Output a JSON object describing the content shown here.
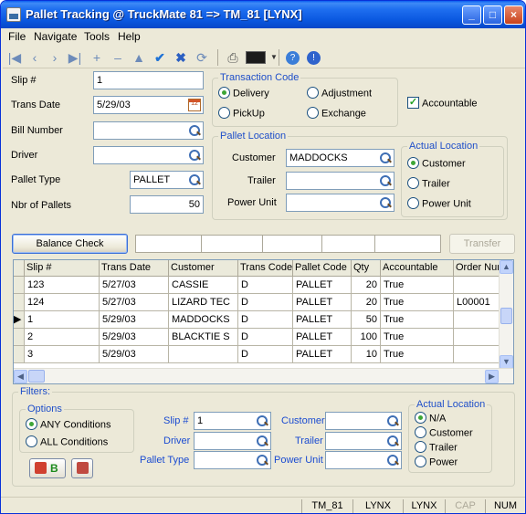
{
  "window": {
    "title": "Pallet Tracking @ TruckMate 81 => TM_81 [LYNX]",
    "controls": {
      "minimize": "_",
      "maximize": "□",
      "close": "×"
    }
  },
  "menu": [
    "File",
    "Navigate",
    "Tools",
    "Help"
  ],
  "toolbar": {
    "icons": [
      "first-icon",
      "prev-icon",
      "next-icon",
      "last-icon",
      "add-icon",
      "delete-icon",
      "up-icon",
      "post-icon",
      "cancel-icon",
      "refresh-icon",
      "print-icon",
      "monitor-icon",
      "help-icon",
      "info-icon"
    ],
    "glyphs": {
      "first": "|◀",
      "prev": "‹",
      "next": "›",
      "last": "▶|",
      "add": "+",
      "delete": "–",
      "up": "▲",
      "check": "✔",
      "cancel": "✖",
      "refresh": "⟳",
      "print": "⎙",
      "help": "?",
      "info": "!"
    }
  },
  "form": {
    "slip_label": "Slip #",
    "slip_value": "1",
    "trans_date_label": "Trans Date",
    "trans_date_value": "5/29/03",
    "bill_number_label": "Bill Number",
    "bill_number_value": "",
    "driver_label": "Driver",
    "driver_value": "",
    "pallet_type_label": "Pallet Type",
    "pallet_type_value": "PALLET",
    "nbr_pallets_label": "Nbr of Pallets",
    "nbr_pallets_value": "50",
    "calendar_text": "12"
  },
  "transaction_code": {
    "title": "Transaction Code",
    "options": [
      {
        "label": "Delivery",
        "selected": true
      },
      {
        "label": "Adjustment",
        "selected": false
      },
      {
        "label": "PickUp",
        "selected": false
      },
      {
        "label": "Exchange",
        "selected": false
      }
    ]
  },
  "accountable": {
    "label": "Accountable",
    "checked": true,
    "mark": "✓"
  },
  "pallet_location": {
    "title": "Pallet Location",
    "customer_label": "Customer",
    "customer_value": "MADDOCKS",
    "trailer_label": "Trailer",
    "trailer_value": "",
    "power_unit_label": "Power Unit",
    "power_unit_value": ""
  },
  "actual_location": {
    "title": "Actual Location",
    "options": [
      {
        "label": "Customer",
        "selected": true
      },
      {
        "label": "Trailer",
        "selected": false
      },
      {
        "label": "Power Unit",
        "selected": false
      }
    ]
  },
  "actions": {
    "balance_check": "Balance Check",
    "transfer": "Transfer"
  },
  "grid": {
    "columns": [
      "Slip #",
      "Trans Date",
      "Customer",
      "Trans Code",
      "Pallet Code",
      "Qty",
      "Accountable",
      "Order Nur"
    ],
    "current_marker": "▶",
    "rows": [
      {
        "slip": "123",
        "date": "5/27/03",
        "customer": "CASSIE",
        "code": "D",
        "pallet": "PALLET",
        "qty": "20",
        "acct": "True",
        "order": ""
      },
      {
        "slip": "124",
        "date": "5/27/03",
        "customer": "LIZARD TEC",
        "code": "D",
        "pallet": "PALLET",
        "qty": "20",
        "acct": "True",
        "order": "L00001"
      },
      {
        "slip": "1",
        "date": "5/29/03",
        "customer": "MADDOCKS",
        "code": "D",
        "pallet": "PALLET",
        "qty": "50",
        "acct": "True",
        "order": ""
      },
      {
        "slip": "2",
        "date": "5/29/03",
        "customer": "BLACKTIE S",
        "code": "D",
        "pallet": "PALLET",
        "qty": "100",
        "acct": "True",
        "order": ""
      },
      {
        "slip": "3",
        "date": "5/29/03",
        "customer": "",
        "code": "D",
        "pallet": "PALLET",
        "qty": "10",
        "acct": "True",
        "order": ""
      }
    ],
    "scroll_glyphs": {
      "up": "▲",
      "down": "▼",
      "left": "◀",
      "right": "▶"
    }
  },
  "filters": {
    "title": "Filters:",
    "options_title": "Options",
    "options": [
      {
        "label": "ANY Conditions",
        "selected": true
      },
      {
        "label": "ALL Conditions",
        "selected": false
      }
    ],
    "slip_label": "Slip #",
    "slip_value": "1",
    "driver_label": "Driver",
    "driver_value": "",
    "pallet_type_label": "Pallet Type",
    "pallet_type_value": "",
    "customer_label": "Customer",
    "customer_value": "",
    "trailer_label": "Trailer",
    "trailer_value": "",
    "power_unit_label": "Power Unit",
    "power_unit_value": "",
    "actual_location_title": "Actual Location",
    "actual_location_options": [
      {
        "label": "N/A",
        "selected": true
      },
      {
        "label": "Customer",
        "selected": false
      },
      {
        "label": "Trailer",
        "selected": false
      },
      {
        "label": "Power",
        "selected": false
      }
    ],
    "apply_button_text": "B"
  },
  "status": [
    "TM_81",
    "LYNX",
    "LYNX",
    "CAP",
    "NUM"
  ]
}
